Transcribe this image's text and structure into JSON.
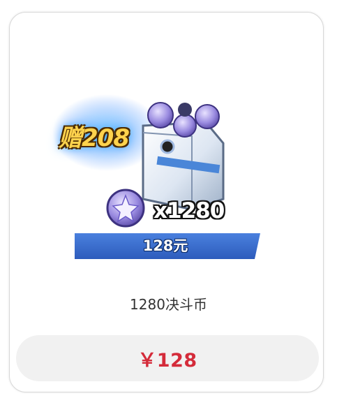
{
  "product": {
    "bonus_text": "赠208",
    "quantity_text": "x1280",
    "banner_price": "128元",
    "name": "1280决斗币",
    "buy_price": "￥128"
  },
  "colors": {
    "price_red": "#d42b3a",
    "banner_blue": "#3e6fd0",
    "bonus_gold": "#ffd34d"
  },
  "icons": [
    "coin-chest-icon",
    "duel-coin-icon"
  ]
}
